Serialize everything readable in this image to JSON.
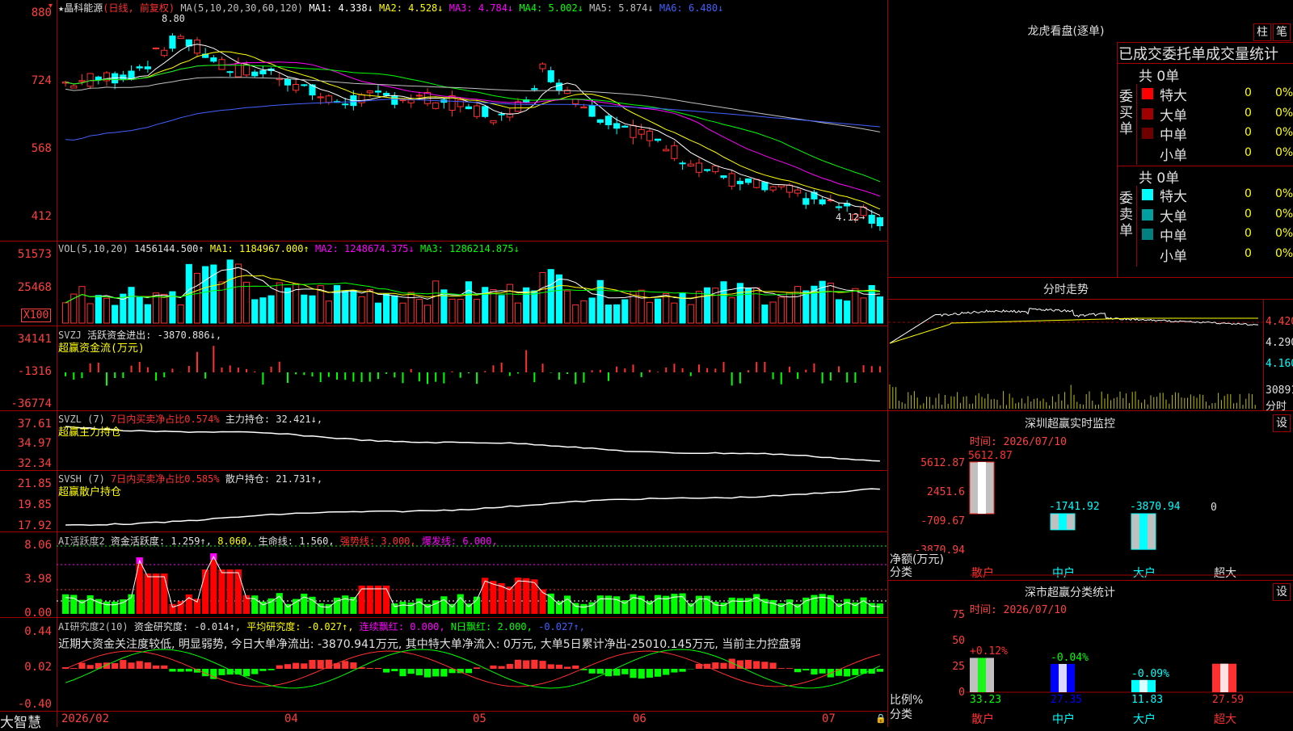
{
  "stock": {
    "name": "★晶科能源",
    "period": "(日线, 前复权)",
    "high_mark": "8.80",
    "low_mark": "4.12→"
  },
  "colors": {
    "up": "#ff3030",
    "down": "#00ffff",
    "grid": "#a00000",
    "ma1": "#ffffff",
    "ma2": "#ffff00",
    "ma3": "#ff00ff",
    "ma4": "#00ff00",
    "ma5": "#c0c0c0",
    "ma6": "#4060ff"
  },
  "price_panel": {
    "title": "MA(5,10,20,30,60,120)",
    "ma": [
      {
        "label": "MA1: 4.338↓",
        "color": "#ffffff"
      },
      {
        "label": "MA2: 4.528↓",
        "color": "#ffff00"
      },
      {
        "label": "MA3: 4.784↓",
        "color": "#ff00ff"
      },
      {
        "label": "MA4: 5.002↓",
        "color": "#00ff00"
      },
      {
        "label": "MA5: 5.874↓",
        "color": "#c0c0c0"
      },
      {
        "label": "MA6: 6.480↓",
        "color": "#4060ff"
      }
    ],
    "yticks": [
      "880",
      "724",
      "568",
      "412"
    ]
  },
  "vol_panel": {
    "title": "VOL(5,10,20)",
    "value": "1456144.500↑",
    "ma1": "MA1: 1184967.000↑",
    "ma2": "MA2: 1248674.375↓",
    "ma3": "MA3: 1286214.875↓",
    "yticks": [
      "51573",
      "25468"
    ],
    "unit": "X100"
  },
  "svzj_panel": {
    "title": "SVZJ",
    "label": "活跃资金进出: -3870.886↓,",
    "sub": "超赢资金流(万元)",
    "yticks": [
      "34141",
      "-1316",
      "-36774"
    ]
  },
  "svzl_panel": {
    "title": "SVZL (7)",
    "ratio": "7日内买卖净占比0.574%",
    "hold": "主力持仓: 32.421↓,",
    "sub": "超赢主力持仓",
    "yticks": [
      "37.61",
      "34.97",
      "32.34"
    ]
  },
  "svsh_panel": {
    "title": "SVSH (7)",
    "ratio": "7日内买卖净占比0.585%",
    "hold": "散户持仓: 21.731↑,",
    "sub": "超赢散户持仓",
    "yticks": [
      "21.85",
      "19.85",
      "17.92"
    ]
  },
  "ai_act_panel": {
    "title": "AI活跃度2",
    "act": "资金活跃度: 1.259↑,",
    "v2": "8.060,",
    "life": "生命线: 1.560,",
    "strong": "强势线: 3.000,",
    "burst": "爆发线: 6.000,",
    "yticks": [
      "8.06",
      "3.98",
      "0.00"
    ]
  },
  "ai_res_panel": {
    "title": "AI研究度2(10)",
    "res": "资金研究度: -0.014↑,",
    "avg": "平均研究度: -0.027↑,",
    "red": "连续飘红: 0.000,",
    "nred": "N日飘红: 2.000,",
    "extra": "-0.027↑,",
    "comment": "近期大资金关注度较低, 明显弱势, 今日大单净流出: -3870.941万元, 其中特大单净流入: 0万元, 大单5日累计净出-25010.145万元, 当前主力控盘弱",
    "yticks": [
      "0.44",
      "0.02",
      "-0.40"
    ]
  },
  "x_axis": [
    "2026/02",
    "04",
    "05",
    "06",
    "07"
  ],
  "brand": "大智慧",
  "right": {
    "longhu_title": "龙虎看盘(逐单)",
    "btn_zhu": "柱",
    "btn_bi": "笔",
    "tabs": "已成交委托单成交量统计",
    "buy_label": "委买单",
    "sell_label": "委卖单",
    "buy_total": "共 0单",
    "sell_total": "共 0单",
    "buy_rows": [
      {
        "name": "特大",
        "n": "0",
        "pct": "0%",
        "color": "#ff0000"
      },
      {
        "name": "大单",
        "n": "0",
        "pct": "0%",
        "color": "#a00000"
      },
      {
        "name": "中单",
        "n": "0",
        "pct": "0%",
        "color": "#700000"
      },
      {
        "name": "小单",
        "n": "0",
        "pct": "0%",
        "color": ""
      }
    ],
    "sell_rows": [
      {
        "name": "特大",
        "n": "0",
        "pct": "0%",
        "color": "#00ffff"
      },
      {
        "name": "大单",
        "n": "0",
        "pct": "0%",
        "color": "#00a0a0"
      },
      {
        "name": "中单",
        "n": "0",
        "pct": "0%",
        "color": "#008080"
      },
      {
        "name": "小单",
        "n": "0",
        "pct": "0%",
        "color": ""
      }
    ],
    "intraday_title": "分时走势",
    "intraday_ticks": [
      "4.420",
      "4.290",
      "4.160",
      "30891"
    ],
    "intraday_unit": "分时",
    "monitor_title": "深圳超赢实时监控",
    "monitor_btn": "设",
    "monitor_time": "时间: 2026/07/10",
    "monitor_yticks": [
      "5612.87",
      "2451.6",
      "-709.67",
      "-3870.94"
    ],
    "monitor_ylabel": "净额(万元)",
    "monitor_xlabel": "分类",
    "monitor_bars": [
      {
        "label": "5612.87",
        "cat": "散户",
        "value": 5612.87
      },
      {
        "label": "-1741.92",
        "cat": "中户",
        "value": -1741.92
      },
      {
        "label": "-3870.94",
        "cat": "大户",
        "value": -3870.94
      },
      {
        "label": "0",
        "cat": "超大",
        "value": 0
      }
    ],
    "stat_title": "深市超赢分类统计",
    "stat_btn": "设",
    "stat_time": "时间: 2026/07/10",
    "stat_yticks": [
      "75",
      "50",
      "25",
      "0"
    ],
    "stat_ylabel": "比例%",
    "stat_xlabel": "分类",
    "stat_bars": [
      {
        "cat": "散户",
        "value": 33.23,
        "label": "33.23",
        "delta": "+0.12%"
      },
      {
        "cat": "中户",
        "value": 27.35,
        "label": "27.35",
        "delta": "-0.04%"
      },
      {
        "cat": "大户",
        "value": 11.83,
        "label": "11.83",
        "delta": "-0.09%"
      },
      {
        "cat": "超大",
        "value": 27.59,
        "label": "27.59",
        "delta": ""
      }
    ]
  }
}
